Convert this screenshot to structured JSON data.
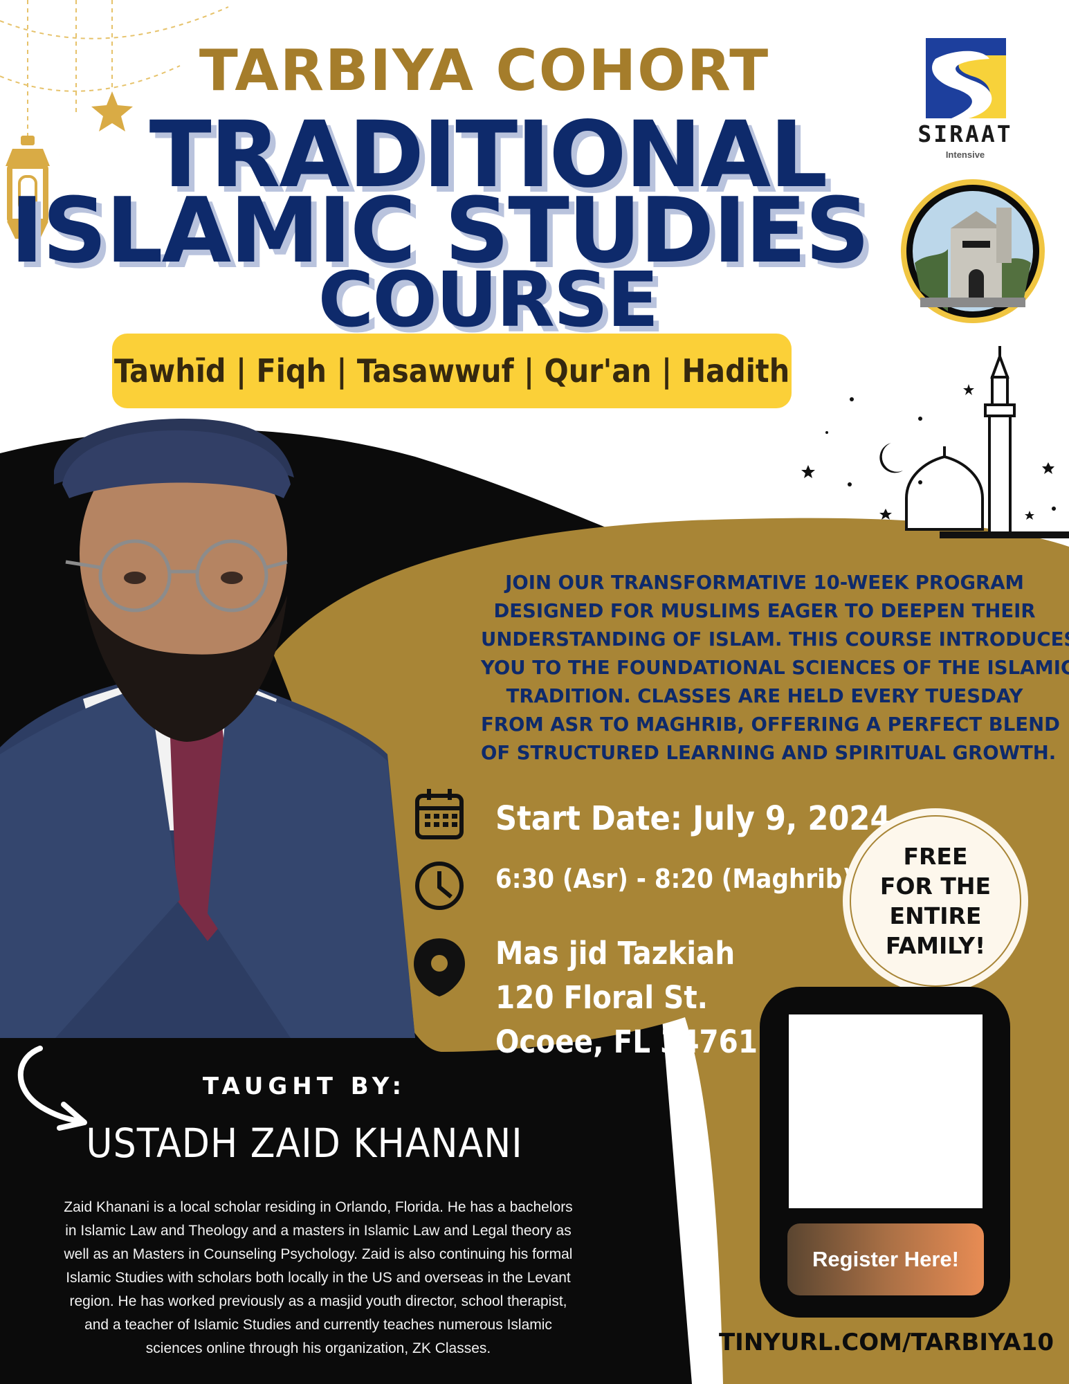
{
  "header": {
    "kicker": "TARBIYA COHORT",
    "title_line1": "TRADITIONAL",
    "title_line2": "ISLAMIC STUDIES",
    "title_line3": "COURSE",
    "subjects": "Tawhīd | Fiqh | Tasawwuf | Qur'an | Hadith"
  },
  "logo": {
    "name": "SIRAAT",
    "sub": "Intensive"
  },
  "description_lines": [
    "Join our transformative 10-week program",
    "designed for Muslims eager to deepen their",
    "understanding of Islam. This course introduces",
    "you to the foundational sciences of the Islamic",
    "tradition. Classes are held every Tuesday",
    "from Asr to Maghrib, offering a perfect blend",
    "of structured learning and spiritual growth."
  ],
  "details": {
    "start_date": "Start Date: July 9, 2024",
    "time": "6:30 (Asr) - 8:20 (Maghrib)",
    "location_line1": "Mas jid Tazkiah",
    "location_line2": "120 Floral St.",
    "location_line3": "Ocoee, FL 34761"
  },
  "badge_lines": [
    "FREE",
    "FOR THE",
    "ENTIRE",
    "FAMILY!"
  ],
  "register": {
    "button": "Register Here!",
    "url": "TINYURL.COM/TARBIYA10"
  },
  "instructor": {
    "taught_by": "TAUGHT BY:",
    "name": "USTADH ZAID KHANANI",
    "bio_lines": [
      "Zaid Khanani is a local scholar residing in Orlando, Florida. He has a bachelors",
      "in Islamic Law and Theology and a masters in Islamic Law and Legal theory as",
      "well as an Masters in Counseling Psychology. Zaid is also continuing his formal",
      "Islamic Studies with scholars both locally in the US and overseas in the Levant",
      "region. He has worked previously as a masjid youth director, school therapist,",
      "and a teacher of Islamic Studies and currently teaches numerous Islamic",
      "sciences online through his organization, ZK Classes."
    ]
  },
  "colors": {
    "gold": "#a88536",
    "navy": "#0e2a6b",
    "yellow": "#fbd038",
    "black": "#0b0b0b"
  }
}
